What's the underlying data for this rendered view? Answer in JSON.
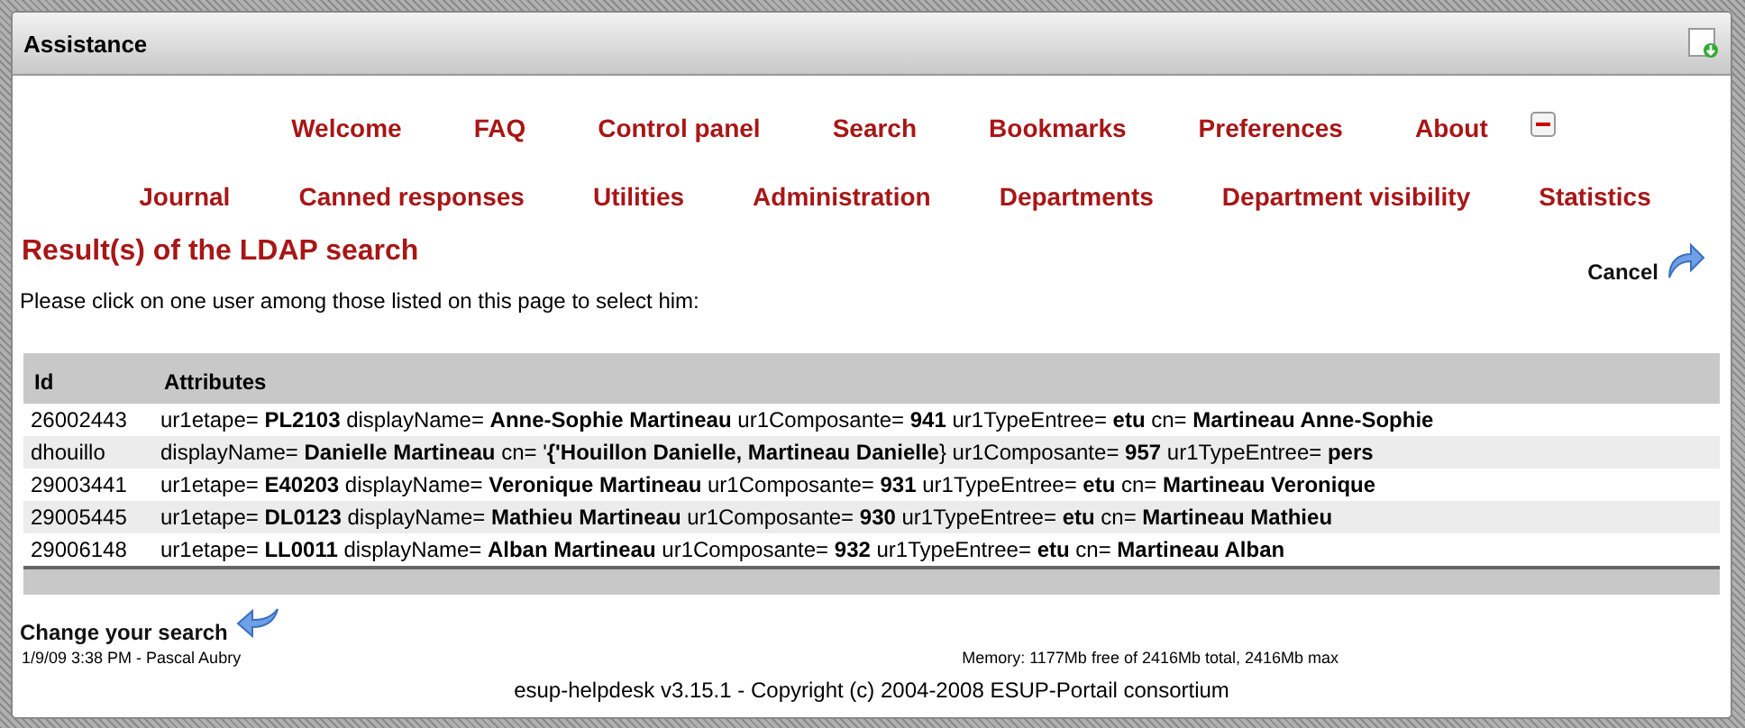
{
  "window": {
    "title": "Assistance"
  },
  "menu_rows": [
    [
      "Welcome",
      "FAQ",
      "Control panel",
      "Search",
      "Bookmarks",
      "Preferences",
      "About"
    ],
    [
      "Journal",
      "Canned responses",
      "Utilities",
      "Administration",
      "Departments",
      "Department visibility",
      "Statistics"
    ]
  ],
  "heading": "Result(s) of the LDAP search",
  "cancel": "Cancel",
  "instruction": "Please click on one user among those listed on this page to select him:",
  "table": {
    "columns": [
      "Id",
      "Attributes"
    ],
    "rows": [
      {
        "id": "26002443",
        "attributes": "ur1etape= **PL2103** displayName= **Anne-Sophie Martineau** ur1Composante= **941** ur1TypeEntree= **etu** cn= **Martineau Anne-Sophie**"
      },
      {
        "id": "dhouillo",
        "attributes": "displayName= **Danielle Martineau** cn= '**{'Houillon Danielle, Martineau Danielle**} ur1Composante= **957** ur1TypeEntree= **pers**"
      },
      {
        "id": "29003441",
        "attributes": "ur1etape= **E40203** displayName= **Veronique Martineau** ur1Composante= **931** ur1TypeEntree= **etu** cn= **Martineau Veronique**"
      },
      {
        "id": "29005445",
        "attributes": "ur1etape= **DL0123** displayName= **Mathieu Martineau** ur1Composante= **930** ur1TypeEntree= **etu** cn= **Martineau Mathieu**"
      },
      {
        "id": "29006148",
        "attributes": "ur1etape= **LL0011** displayName= **Alban Martineau** ur1Composante= **932** ur1TypeEntree= **etu** cn= **Martineau Alban**"
      }
    ]
  },
  "change_search": "Change your search",
  "user_info": "1/9/09 3:38 PM - Pascal Aubry",
  "memory": "Memory: 1177Mb free of 2416Mb total, 2416Mb max",
  "copyright": "esup-helpdesk v3.15.1 - Copyright (c) 2004-2008 ESUP-Portail consortium"
}
